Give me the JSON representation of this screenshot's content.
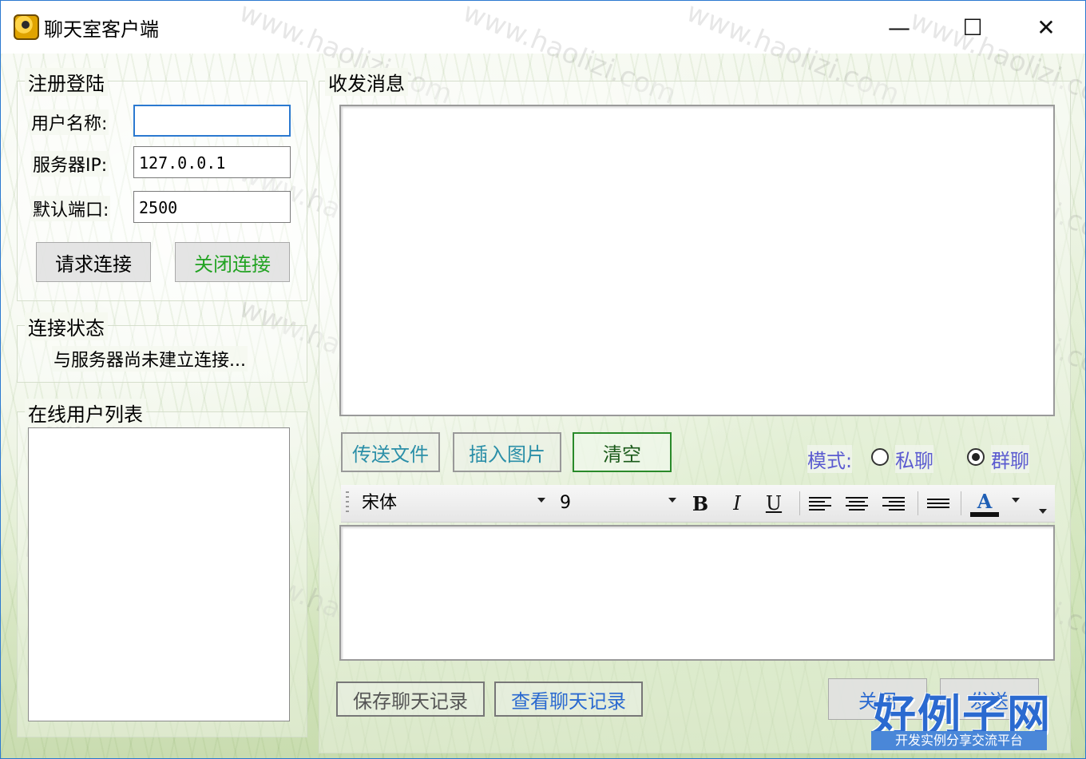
{
  "window": {
    "title": "聊天室客户端",
    "minimize_glyph": "—",
    "maximize_glyph": "☐",
    "close_glyph": "✕"
  },
  "login_group": {
    "legend": "注册登陆",
    "username_label": "用户名称:",
    "username_value": "",
    "server_ip_label": "服务器IP:",
    "server_ip_value": "127.0.0.1",
    "port_label": "默认端口:",
    "port_value": "2500",
    "connect_button": "请求连接",
    "disconnect_button": "关闭连接"
  },
  "status_group": {
    "legend": "连接状态",
    "status_text": "与服务器尚未建立连接..."
  },
  "online_group": {
    "legend": "在线用户列表",
    "users": []
  },
  "messages_group": {
    "legend": "收发消息"
  },
  "actions": {
    "send_file": "传送文件",
    "insert_image": "插入图片",
    "clear": "清空"
  },
  "mode": {
    "label": "模式:",
    "private": "私聊",
    "group": "群聊",
    "selected": "group"
  },
  "format_toolbar": {
    "font_name": "宋体",
    "font_size": "9",
    "bold": "B",
    "italic": "I",
    "underline": "U",
    "font_color": "A"
  },
  "bottom_buttons": {
    "save_log": "保存聊天记录",
    "view_log": "查看聊天记录",
    "close": "关闭",
    "send": "发送"
  },
  "watermark": {
    "text": "www.haolizi.com",
    "logo_main": "好例子网",
    "logo_sub": "开发实例分享交流平台"
  },
  "colors": {
    "accent_blue": "#2b79d0",
    "green_text": "#22a322",
    "teal_text": "#2b8fa8",
    "mode_text": "#5b5bd0"
  }
}
